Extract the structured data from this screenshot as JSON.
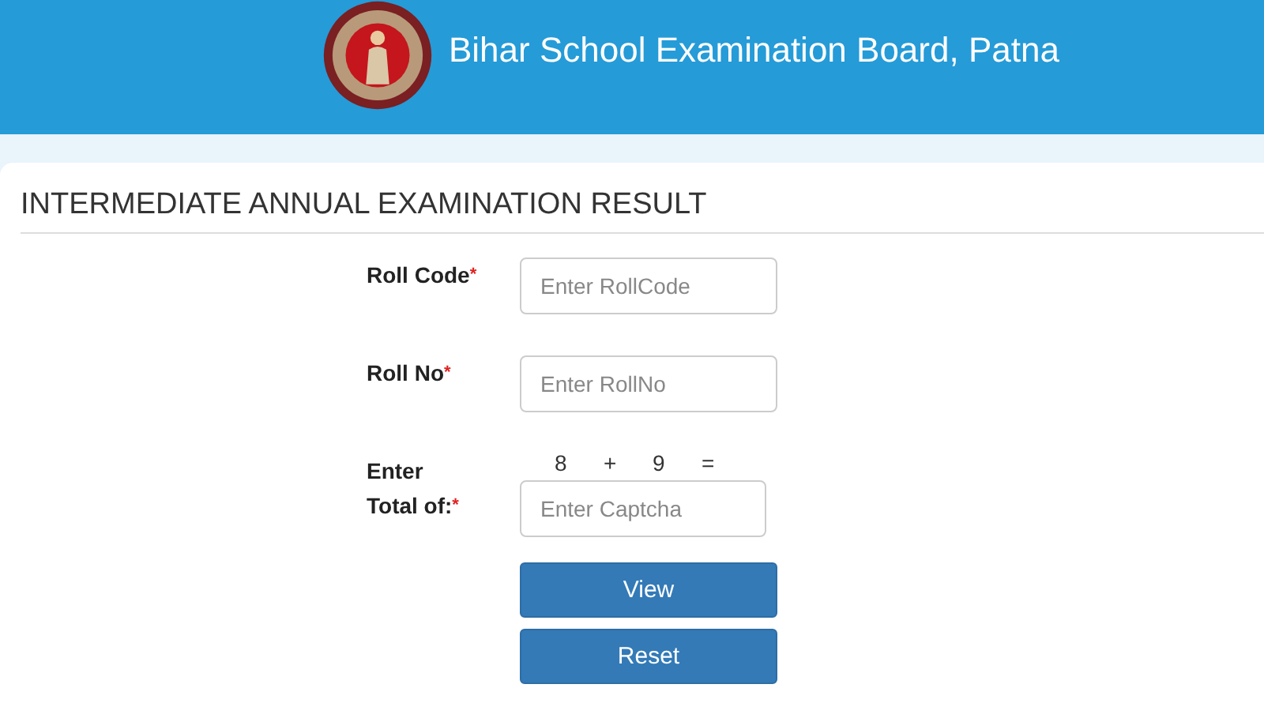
{
  "header": {
    "title": "Bihar School Examination Board, Patna"
  },
  "page_title": "INTERMEDIATE ANNUAL EXAMINATION RESULT",
  "fields": [
    {
      "label": "Roll Code",
      "required_mark": "*",
      "placeholder": "Enter RollCode",
      "kind": "text"
    },
    {
      "label": "Roll No",
      "required_mark": "*",
      "placeholder": "Enter RollNo",
      "kind": "text"
    },
    {
      "label": "Enter Total of:",
      "required_mark": "*",
      "placeholder": "Enter Captcha",
      "kind": "captcha",
      "captcha": [
        "8",
        "+",
        "9",
        "="
      ]
    }
  ],
  "buttons": [
    "View",
    "Reset"
  ]
}
